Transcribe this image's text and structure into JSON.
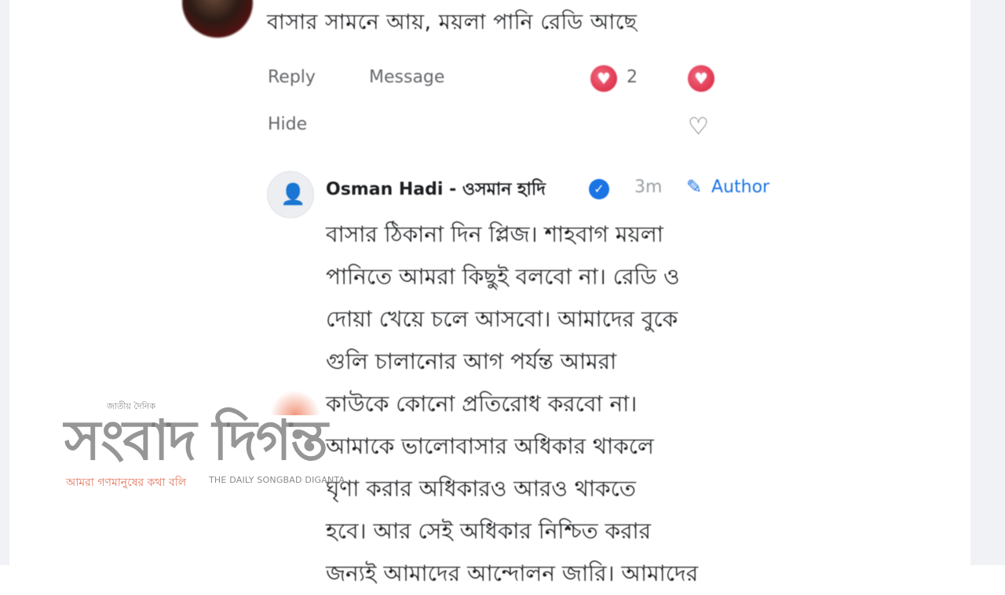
{
  "comment": {
    "text": "বাসার সামনে আয়, ময়লা পানি রেডি আছে",
    "actions": {
      "reply": "Reply",
      "message": "Message",
      "hide": "Hide"
    },
    "reaction_count": "2",
    "icons": {
      "avatar": "avatar",
      "love_reaction": "heart-reaction-icon",
      "like": "like-icon"
    }
  },
  "reply": {
    "author_name": "Osman Hadi - ওসমান হাদি",
    "time": "3m",
    "author_label": "Author",
    "lines": [
      "বাসার ঠিকানা দিন প্লিজ। শাহবাগ ময়লা",
      "পানিতে আমরা কিছুই বলবো না। রেডি ও",
      "দোয়া খেয়ে চলে আসবো। আমাদের বুকে",
      "গুলি চালানোর আগ পর্যন্ত আমরা",
      "কাউকে কোনো প্রতিরোধ করবো না।",
      "আমাকে ভালোবাসার অধিকার থাকলে",
      "ঘৃণা করার অধিকারও আরও থাকতে",
      "হবে। আর সেই অধিকার নিশ্চিত করার",
      "জন্যই আমাদের আন্দোলন জারি। আমাদের"
    ],
    "icons": {
      "verified": "verified-badge-icon",
      "author": "pencil-icon"
    }
  },
  "watermark": {
    "small_text": "জাতীয় দৈনিক",
    "title": "সংবাদ দিগন্ত",
    "tagline": "আমরা গণমানুষের কথা বলি",
    "english": "THE DAILY SONGBAD DIGANTA"
  }
}
